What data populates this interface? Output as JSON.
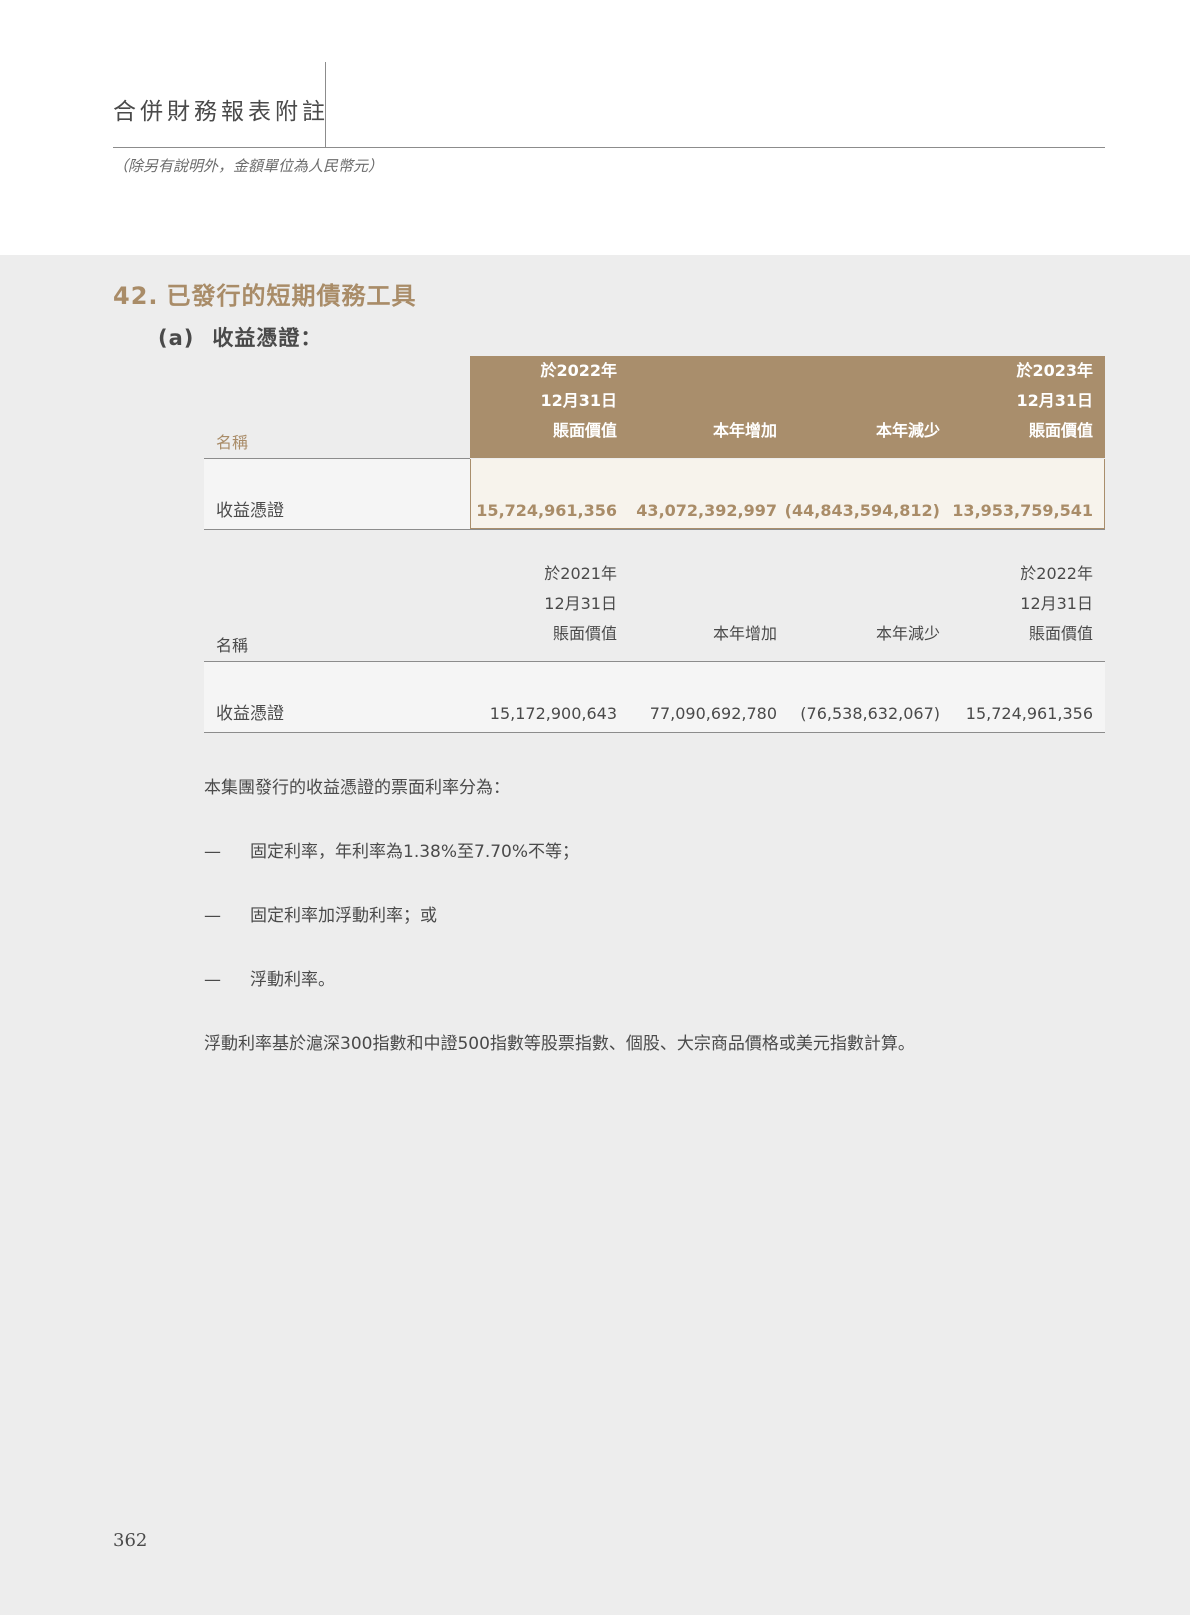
{
  "header": {
    "title": "合併財務報表附註",
    "unit_note": "（除另有說明外，金額單位為人民幣元）"
  },
  "section": {
    "number": "42.",
    "title": "已發行的短期債務工具",
    "sub_label": "(a)",
    "sub_title": "收益憑證："
  },
  "table_2023": {
    "name_header": "名稱",
    "col1": [
      "於2022年",
      "12月31日",
      "賬面價值"
    ],
    "col2": "本年增加",
    "col3": "本年減少",
    "col4": [
      "於2023年",
      "12月31日",
      "賬面價值"
    ],
    "row": {
      "name": "收益憑證",
      "v1": "15,724,961,356",
      "v2": "43,072,392,997",
      "v3": "(44,843,594,812)",
      "v4": "13,953,759,541"
    }
  },
  "table_2022": {
    "name_header": "名稱",
    "col1": [
      "於2021年",
      "12月31日",
      "賬面價值"
    ],
    "col2": "本年增加",
    "col3": "本年減少",
    "col4": [
      "於2022年",
      "12月31日",
      "賬面價值"
    ],
    "row": {
      "name": "收益憑證",
      "v1": "15,172,900,643",
      "v2": "77,090,692,780",
      "v3": "(76,538,632,067)",
      "v4": "15,724,961,356"
    }
  },
  "notes": {
    "intro": "本集團發行的收益憑證的票面利率分為：",
    "bullets": [
      "固定利率，年利率為1.38%至7.70%不等；",
      "固定利率加浮動利率；或",
      "浮動利率。"
    ],
    "dash": "—",
    "closing": "浮動利率基於滬深300指數和中證500指數等股票指數、個股、大宗商品價格或美元指數計算。"
  },
  "page_number": "362"
}
